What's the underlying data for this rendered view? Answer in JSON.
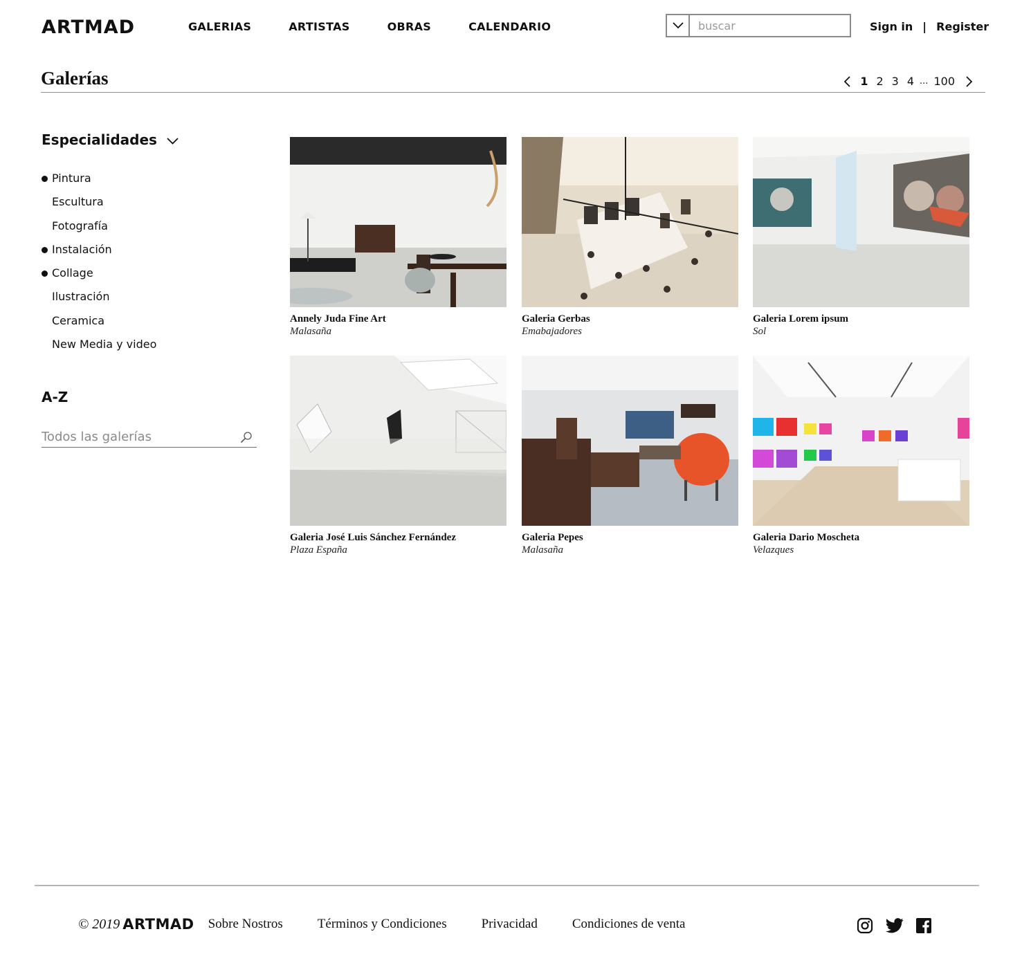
{
  "header": {
    "logo": "ARTMAD",
    "nav": [
      "GALERIAS",
      "ARTISTAS",
      "OBRAS",
      "CALENDARIO"
    ],
    "search_placeholder": "buscar",
    "sign_in": "Sign in",
    "separator": "|",
    "register": "Register"
  },
  "page": {
    "title": "Galerías",
    "pagination": {
      "pages": [
        "1",
        "2",
        "3",
        "4"
      ],
      "active": "1",
      "ellipsis": "...",
      "last": "100"
    }
  },
  "sidebar": {
    "specialties_heading": "Especialidades",
    "specialties": [
      {
        "label": "Pintura",
        "selected": true
      },
      {
        "label": "Escultura",
        "selected": false
      },
      {
        "label": "Fotografía",
        "selected": false
      },
      {
        "label": "Instalación",
        "selected": true
      },
      {
        "label": "Collage",
        "selected": true
      },
      {
        "label": "Ilustración",
        "selected": false
      },
      {
        "label": "Ceramica",
        "selected": false
      },
      {
        "label": "New Media y video",
        "selected": false
      }
    ],
    "az_heading": "A-Z",
    "az_placeholder": "Todos las galerías"
  },
  "galleries": [
    {
      "name": "Annely Juda Fine Art",
      "location": "Malasaña"
    },
    {
      "name": "Galeria Gerbas",
      "location": "Emabajadores"
    },
    {
      "name": "Galeria Lorem ipsum",
      "location": "Sol"
    },
    {
      "name": "Galeria José Luis Sánchez Fernández",
      "location": "Plaza España"
    },
    {
      "name": "Galeria Pepes",
      "location": "Malasaña"
    },
    {
      "name": "Galeria Dario Moscheta",
      "location": "Velazques"
    }
  ],
  "footer": {
    "copyright": "© 2019",
    "logo": "ARTMAD",
    "links": [
      "Sobre Nostros",
      "Términos y Condiciones",
      "Privacidad",
      "Condiciones de venta"
    ],
    "social_icons": [
      "instagram-icon",
      "twitter-icon",
      "facebook-icon"
    ]
  },
  "colors": {
    "text": "#111111",
    "rule": "#8e8e8e",
    "placeholder": "#9a9a9a"
  }
}
